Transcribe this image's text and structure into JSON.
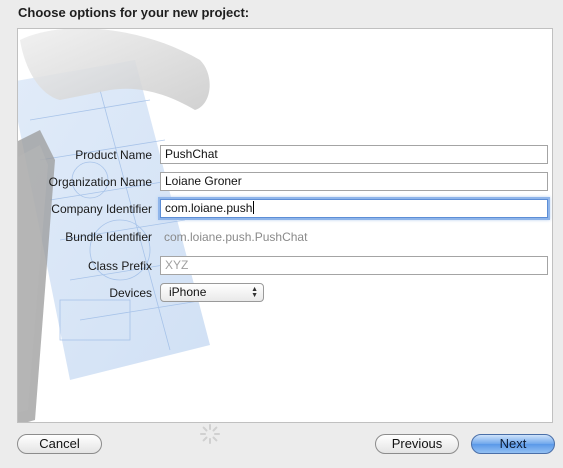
{
  "dialog": {
    "title": "Choose options for your new project:"
  },
  "form": {
    "product_name": {
      "label": "Product Name",
      "value": "PushChat"
    },
    "organization_name": {
      "label": "Organization Name",
      "value": "Loiane Groner"
    },
    "company_identifier": {
      "label": "Company Identifier",
      "value": "com.loiane.push"
    },
    "bundle_identifier": {
      "label": "Bundle Identifier",
      "value": "com.loiane.push.PushChat"
    },
    "class_prefix": {
      "label": "Class Prefix",
      "placeholder": "XYZ"
    },
    "devices": {
      "label": "Devices",
      "value": "iPhone"
    }
  },
  "footer": {
    "cancel_label": "Cancel",
    "previous_label": "Previous",
    "next_label": "Next"
  },
  "icons": {
    "background": "hammer-blueprint-icon",
    "spinner": "progress-spinner-icon",
    "select_arrows": "updown-arrows-icon"
  },
  "colors": {
    "accent": "#5a98e8",
    "focus_ring": "#8fb5ea",
    "blueprint": "#4a86d4"
  }
}
